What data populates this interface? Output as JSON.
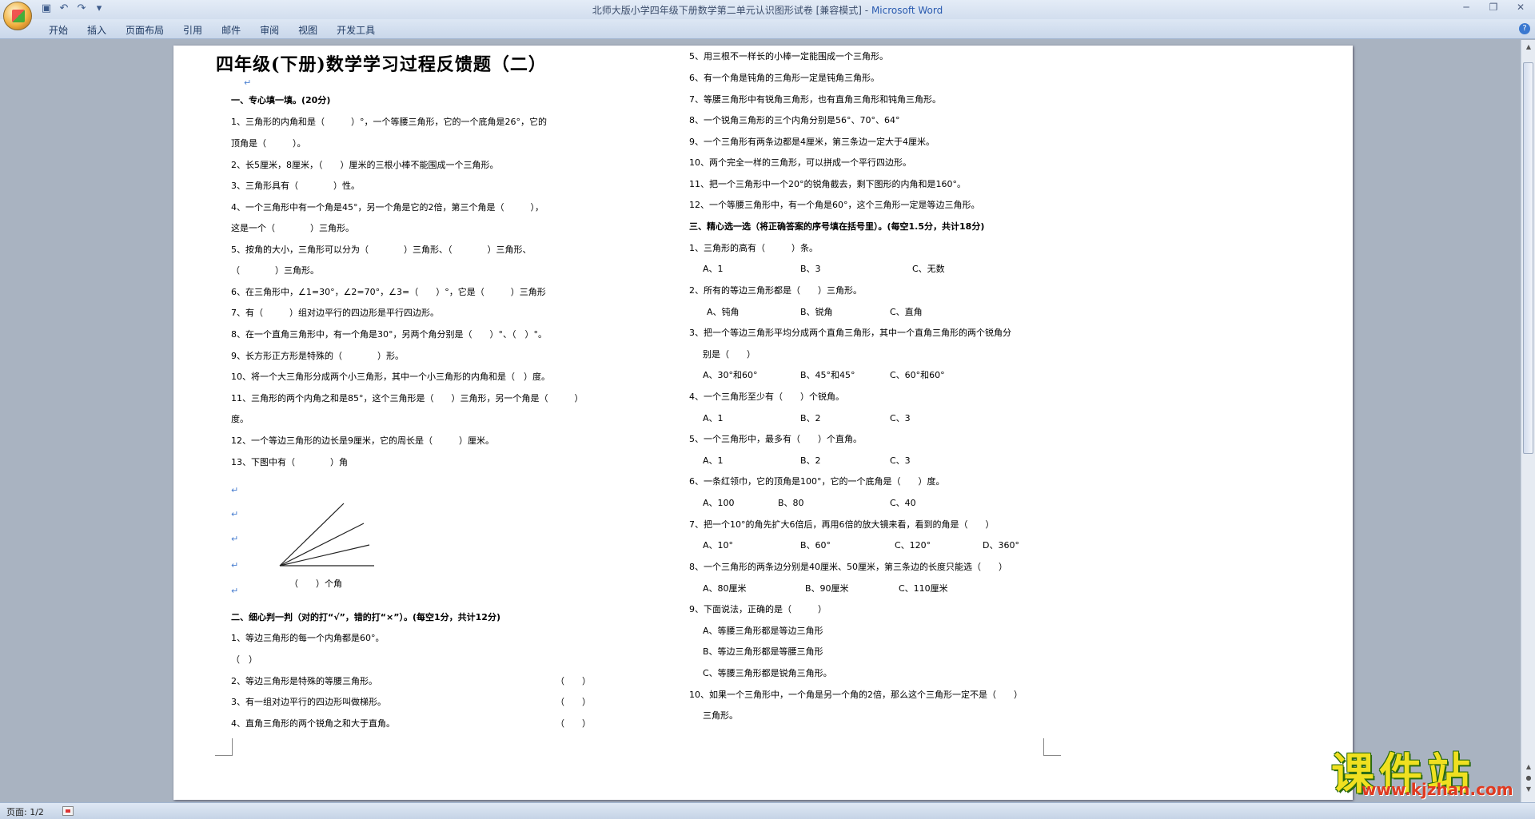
{
  "window": {
    "title": "北师大版小学四年级下册数学第二单元认识图形试卷 [兼容模式]",
    "app": "Microsoft Word",
    "separator": " - "
  },
  "ribbon": {
    "tabs": [
      "开始",
      "插入",
      "页面布局",
      "引用",
      "邮件",
      "审阅",
      "视图",
      "开发工具"
    ]
  },
  "status": {
    "page": "页面: 1/2"
  },
  "document": {
    "heading": "四年级(下册)数学学习过程反馈题（二）",
    "left": [
      "一、专心填一填。(20分)",
      "1、三角形的内角和是（　　　）°，一个等腰三角形，它的一个底角是26°，它的",
      "顶角是（　　　）。",
      "2、长5厘米，8厘米，（　　）厘米的三根小棒不能围成一个三角形。",
      "3、三角形具有（　　　　）性。",
      "4、一个三角形中有一个角是45°，另一个角是它的2倍，第三个角是（　　　），",
      "这是一个（　　　　）三角形。",
      "5、按角的大小，三角形可以分为（　　　　）三角形、（　　　　）三角形、",
      "（　　　　）三角形。",
      "6、在三角形中，∠1=30°，∠2=70°，∠3=（　　）°，它是（　　　）三角形",
      "7、有（　　　）组对边平行的四边形是平行四边形。",
      "8、在一个直角三角形中，有一个角是30°，另两个角分别是（　　）°、（　）°。",
      "9、长方形正方形是特殊的（　　　　）形。",
      "10、将一个大三角形分成两个小三角形，其中一个小三角形的内角和是（　）度。",
      "11、三角形的两个内角之和是85°，这个三角形是（　　）三角形，另一个角是（　　　）",
      "度。",
      "12、一个等边三角形的边长是9厘米，它的周长是（　　　）厘米。",
      "13、下图中有（　　　　）角",
      "（　　）个角",
      "二、细心判一判（对的打“√”，错的打“×”）。(每空1分，共计12分)",
      "1、等边三角形的每一个内角都是60°。",
      "（　）",
      "2、等边三角形是特殊的等腰三角形。",
      "3、有一组对边平行的四边形叫做梯形。",
      "4、直角三角形的两个锐角之和大于直角。",
      "（　　）"
    ],
    "right": [
      "5、用三根不一样长的小棒一定能围成一个三角形。",
      "6、有一个角是钝角的三角形一定是钝角三角形。",
      "7、等腰三角形中有锐角三角形，也有直角三角形和钝角三角形。",
      "8、一个锐角三角形的三个内角分别是56°、70°、64°",
      "9、一个三角形有两条边都是4厘米，第三条边一定大于4厘米。",
      "10、两个完全一样的三角形，可以拼成一个平行四边形。",
      "11、把一个三角形中一个20°的锐角截去，剩下图形的内角和是160°。",
      "12、一个等腰三角形中，有一个角是60°，这个三角形一定是等边三角形。",
      "三、精心选一选（将正确答案的序号填在括号里）。(每空1.5分，共计18分)",
      "1、三角形的高有（　　　）条。",
      "A、1",
      "B、3",
      "C、无数",
      "2、所有的等边三角形都是（　　）三角形。",
      "A、钝角",
      "B、锐角",
      "C、直角",
      "3、把一个等边三角形平均分成两个直角三角形，其中一个直角三角形的两个锐角分",
      "别是（　　）",
      "A、30°和60°",
      "B、45°和45°",
      "C、60°和60°",
      "4、一个三角形至少有（　　）个锐角。",
      "A、1",
      "B、2",
      "C、3",
      "5、一个三角形中，最多有（　　）个直角。",
      "6、一条红领巾，它的顶角是100°，它的一个底角是（　　）度。",
      "A、100",
      "B、80",
      "C、40",
      "7、把一个10°的角先扩大6倍后，再用6倍的放大镜来看，看到的角是（　　）",
      "A、10°",
      "B、60°",
      "C、120°",
      "D、360°",
      "8、一个三角形的两条边分别是40厘米、50厘米，第三条边的长度只能选（　　）",
      "A、80厘米",
      "B、90厘米",
      "C、110厘米",
      "9、下面说法，正确的是（　　　）",
      "A、等腰三角形都是等边三角形",
      "B、等边三角形都是等腰三角形",
      "C、等腰三角形都是锐角三角形。",
      "10、如果一个三角形中，一个角是另一个角的2倍，那么这个三角形一定不是（　　）",
      "三角形。",
      "（　　）"
    ]
  },
  "watermark": {
    "main": "课件站",
    "url": "www.kjzhan.com"
  }
}
